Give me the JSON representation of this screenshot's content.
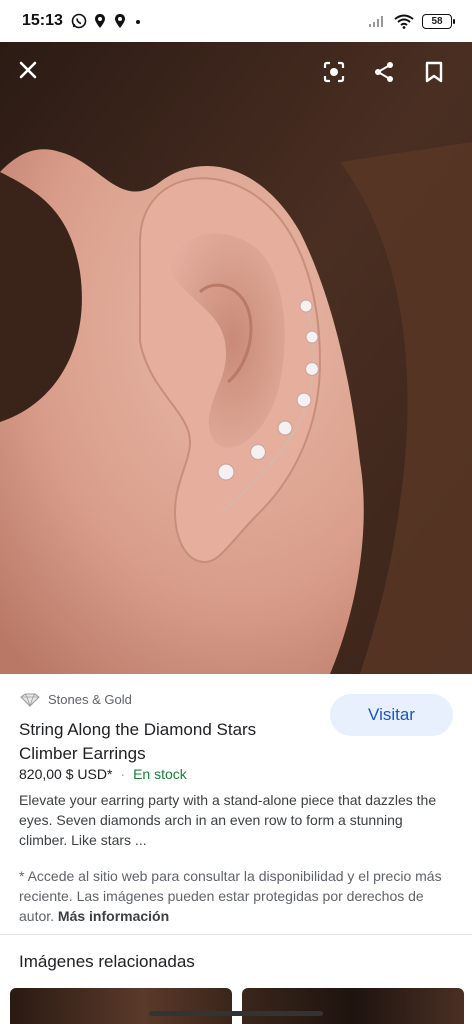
{
  "status_bar": {
    "time": "15:13",
    "battery": "58"
  },
  "product": {
    "source_name": "Stones & Gold",
    "title": "String Along the Diamond Stars Climber Earrings",
    "price": "820,00 $ USD*",
    "separator": "·",
    "availability": "En stock",
    "description": "Elevate your earring party with a stand-alone piece that dazzles the eyes. Seven diamonds arch in an even row to form a stunning climber. Like stars ...",
    "visit_label": "Visitar"
  },
  "notice": {
    "text": "* Accede al sitio web para consultar la disponibilidad y el precio más reciente. Las imágenes pueden estar protegidas por derechos de autor.",
    "more_info": "Más información"
  },
  "related": {
    "title": "Imágenes relacionadas"
  },
  "colors": {
    "accent": "#1a56c4",
    "visit_bg": "#e8f0fe",
    "stock": "#188038"
  },
  "icons": [
    "close-icon",
    "lens-icon",
    "share-icon",
    "bookmark-icon",
    "diamond-icon"
  ]
}
